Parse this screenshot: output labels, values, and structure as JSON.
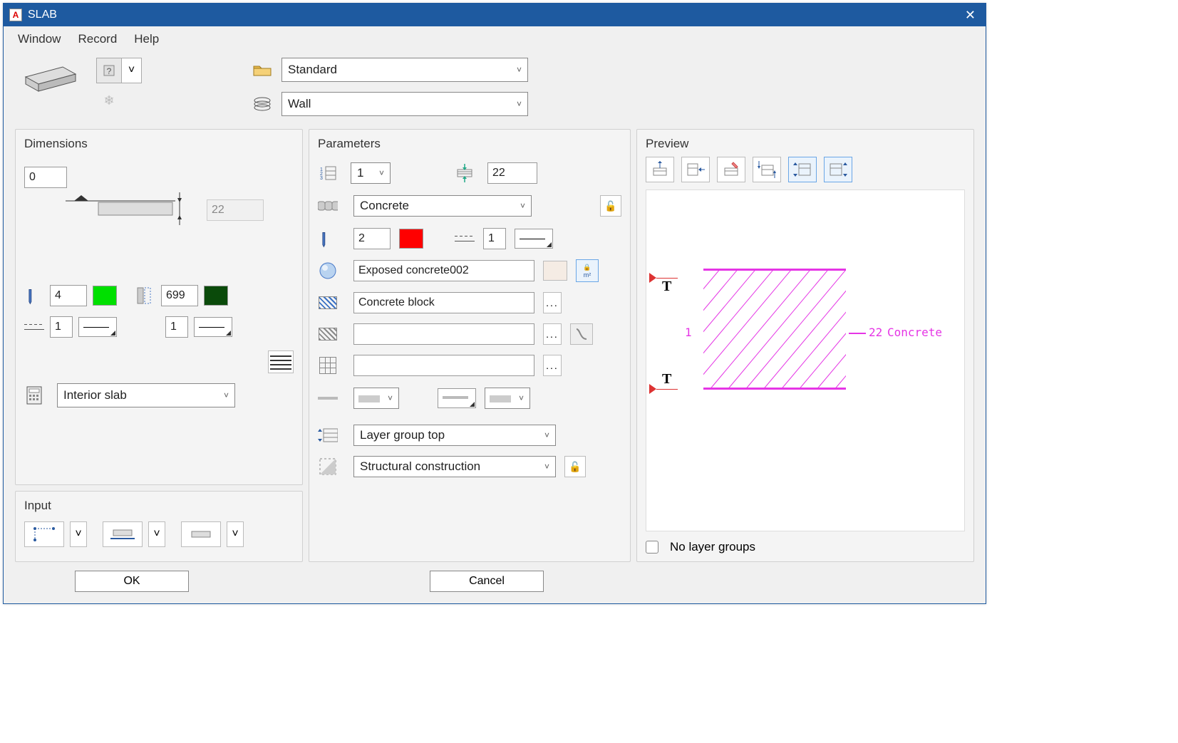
{
  "title": "SLAB",
  "menu": {
    "window": "Window",
    "record": "Record",
    "help": "Help"
  },
  "library": {
    "folder": "Standard",
    "layer": "Wall"
  },
  "sections": {
    "dimensions": "Dimensions",
    "parameters": "Parameters",
    "preview": "Preview",
    "input": "Input"
  },
  "dimensions": {
    "height_offset": "0",
    "thickness_ro": "22",
    "pen2d": "4",
    "pen3d": "699",
    "line2d": "1",
    "line3d": "1",
    "slab_type": "Interior slab"
  },
  "parameters": {
    "layer_no": "1",
    "thickness": "22",
    "material": "Concrete",
    "pen": "2",
    "line": "1",
    "surface": "Exposed concrete002",
    "hatch": "Concrete block",
    "fill": "",
    "brick": "",
    "layer_group": "Layer group top",
    "structure": "Structural construction"
  },
  "preview": {
    "layer_label": "1",
    "thick_label": "22",
    "mat_label": "Concrete",
    "no_groups": "No layer groups"
  },
  "buttons": {
    "ok": "OK",
    "cancel": "Cancel"
  },
  "colors": {
    "pen2d": "#00e000",
    "pen3d": "#0a4a0a",
    "penpar": "#ff0000"
  }
}
